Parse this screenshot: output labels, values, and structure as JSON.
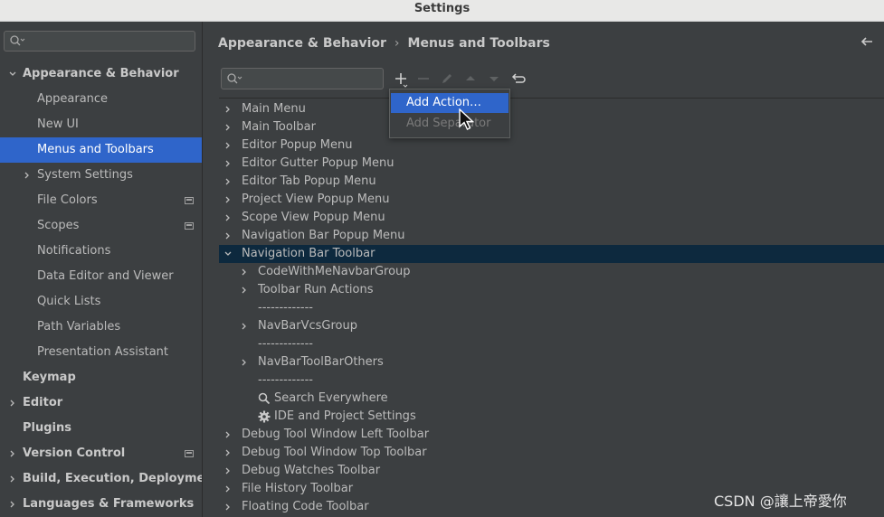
{
  "window": {
    "title": "Settings"
  },
  "sidebar": {
    "search": {
      "value": "",
      "placeholder": ""
    },
    "items": [
      {
        "label": "Appearance & Behavior",
        "expanded": true
      },
      {
        "label": "Appearance"
      },
      {
        "label": "New UI"
      },
      {
        "label": "Menus and Toolbars",
        "selected": true
      },
      {
        "label": "System Settings"
      },
      {
        "label": "File Colors"
      },
      {
        "label": "Scopes"
      },
      {
        "label": "Notifications"
      },
      {
        "label": "Data Editor and Viewer"
      },
      {
        "label": "Quick Lists"
      },
      {
        "label": "Path Variables"
      },
      {
        "label": "Presentation Assistant"
      },
      {
        "label": "Keymap"
      },
      {
        "label": "Editor"
      },
      {
        "label": "Plugins"
      },
      {
        "label": "Version Control"
      },
      {
        "label": "Build, Execution, Deployment"
      },
      {
        "label": "Languages & Frameworks"
      }
    ]
  },
  "main": {
    "breadcrumb": {
      "parent": "Appearance & Behavior",
      "separator": "›",
      "current": "Menus and Toolbars"
    },
    "search": {
      "value": "",
      "placeholder": ""
    },
    "toolbar_icons": [
      "add-icon",
      "remove-icon",
      "edit-icon",
      "move-up-icon",
      "move-down-icon",
      "restore-icon"
    ],
    "tree": [
      {
        "label": "Main Menu"
      },
      {
        "label": "Main Toolbar"
      },
      {
        "label": "Editor Popup Menu"
      },
      {
        "label": "Editor Gutter Popup Menu"
      },
      {
        "label": "Editor Tab Popup Menu"
      },
      {
        "label": "Project View Popup Menu"
      },
      {
        "label": "Scope View Popup Menu"
      },
      {
        "label": "Navigation Bar Popup Menu"
      },
      {
        "label": "Navigation Bar Toolbar",
        "expanded": true,
        "selected": true
      },
      {
        "label": "CodeWithMeNavbarGroup"
      },
      {
        "label": "Toolbar Run Actions"
      },
      {
        "label": "-------------"
      },
      {
        "label": "NavBarVcsGroup"
      },
      {
        "label": "-------------"
      },
      {
        "label": "NavBarToolBarOthers"
      },
      {
        "label": "-------------"
      },
      {
        "label": "Search Everywhere",
        "icon": "search-icon"
      },
      {
        "label": "IDE and Project Settings",
        "icon": "gear-icon"
      },
      {
        "label": "Debug Tool Window Left Toolbar"
      },
      {
        "label": "Debug Tool Window Top Toolbar"
      },
      {
        "label": "Debug Watches Toolbar"
      },
      {
        "label": "File History Toolbar"
      },
      {
        "label": "Floating Code Toolbar"
      }
    ]
  },
  "popup": {
    "items": [
      {
        "label": "Add Action…",
        "active": true
      },
      {
        "label": "Add Separator",
        "disabled": true
      }
    ]
  },
  "watermark": "CSDN @讓上帝愛你",
  "colors": {
    "selection": "#2f65ca",
    "tree_selection": "#0d293e",
    "background": "#3c3f41"
  }
}
